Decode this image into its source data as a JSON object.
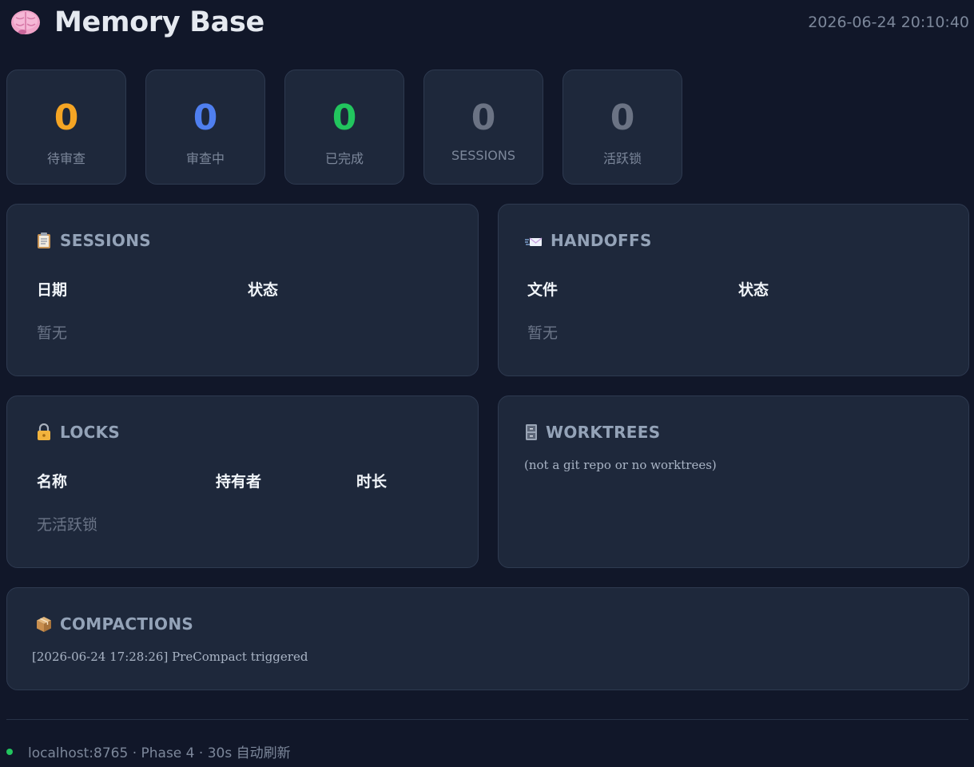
{
  "header": {
    "title": "Memory Base",
    "timestamp": "2026-06-24 20:10:40",
    "icon": "brain-icon"
  },
  "stats": [
    {
      "value": "0",
      "label": "待审查",
      "color": "#f5a524"
    },
    {
      "value": "0",
      "label": "审查中",
      "color": "#4f7ff0"
    },
    {
      "value": "0",
      "label": "已完成",
      "color": "#22c55e"
    },
    {
      "value": "0",
      "label": "SESSIONS",
      "color": "#6b7384"
    },
    {
      "value": "0",
      "label": "活跃锁",
      "color": "#6b7384"
    }
  ],
  "sessions": {
    "icon": "clipboard-icon",
    "title": "SESSIONS",
    "columns": [
      "日期",
      "状态"
    ],
    "empty": "暂无"
  },
  "handoffs": {
    "icon": "incoming-envelope-icon",
    "title": "HANDOFFS",
    "columns": [
      "文件",
      "状态"
    ],
    "empty": "暂无"
  },
  "locks": {
    "icon": "lock-icon",
    "title": "LOCKS",
    "columns": [
      "名称",
      "持有者",
      "时长"
    ],
    "empty": "无活跃锁"
  },
  "worktrees": {
    "icon": "file-cabinet-icon",
    "title": "WORKTREES",
    "message": "(not a git repo or no worktrees)"
  },
  "compactions": {
    "icon": "package-icon",
    "title": "COMPACTIONS",
    "log": "[2026-06-24 17:28:26] PreCompact triggered"
  },
  "footer": {
    "text": "localhost:8765 · Phase 4 · 30s 自动刷新",
    "status_color": "#22c55e"
  }
}
